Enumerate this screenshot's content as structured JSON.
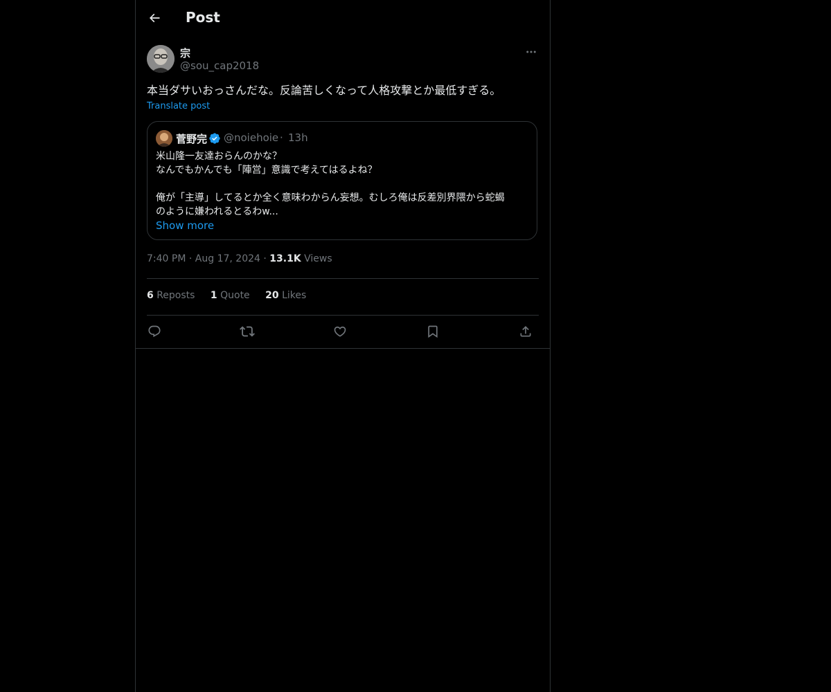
{
  "header": {
    "title": "Post"
  },
  "post": {
    "author_name": "宗",
    "author_handle": "@sou_cap2018",
    "text": "本当ダサいおっさんだな。反論苦しくなって人格攻撃とか最低すぎる。",
    "translate_label": "Translate post",
    "time": "7:40 PM",
    "date": "Aug 17, 2024",
    "separator": "·",
    "views_count": "13.1K",
    "views_label": "Views"
  },
  "quote": {
    "author_name": "菅野完",
    "author_handle": "@noiehoie",
    "separator": "·",
    "time": "13h",
    "lines": [
      "米山隆一友達おらんのかな？",
      "なんでもかんでも「陣営」意識で考えてはるよね？",
      "",
      "俺が「主導」してるとか全く意味わからん妄想。むしろ俺は反差別界隈から蛇蝎",
      "のように嫌われるとるわw..."
    ],
    "show_more": "Show more"
  },
  "stats": {
    "reposts_count": "6",
    "reposts_label": "Reposts",
    "quotes_count": "1",
    "quotes_label": "Quote",
    "likes_count": "20",
    "likes_label": "Likes"
  },
  "icons": {
    "back": "arrow-left-icon",
    "more": "more-horizontal-icon",
    "verified": "verified-badge-icon",
    "reply": "reply-icon",
    "repost": "repost-icon",
    "like": "heart-icon",
    "bookmark": "bookmark-icon",
    "share": "share-icon"
  },
  "colors": {
    "background": "#000000",
    "text": "#e7e9ea",
    "secondary": "#71767b",
    "accent": "#1d9bf0",
    "border": "#2f3336"
  }
}
